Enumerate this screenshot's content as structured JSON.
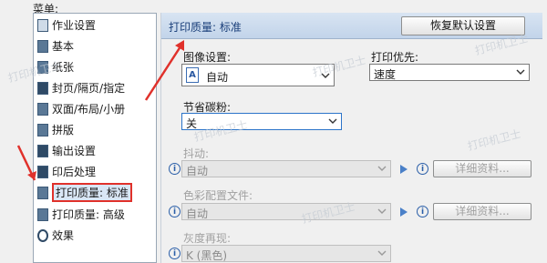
{
  "menu_caption": "菜单:",
  "sidebar": {
    "items": [
      {
        "label": "作业设置"
      },
      {
        "label": "基本"
      },
      {
        "label": "纸张"
      },
      {
        "label": "封页/隔页/指定"
      },
      {
        "label": "双面/布局/小册"
      },
      {
        "label": "拼版"
      },
      {
        "label": "输出设置"
      },
      {
        "label": "印后处理"
      },
      {
        "label": "打印质量: 标准"
      },
      {
        "label": "打印质量: 高级"
      },
      {
        "label": "效果"
      }
    ],
    "selected_index": 8
  },
  "panel": {
    "title": "打印质量: 标准",
    "restore_button": "恢复默认设置",
    "image_settings": {
      "label": "图像设置:",
      "value": "自动"
    },
    "print_priority": {
      "label": "打印优先:",
      "value": "速度"
    },
    "toner_save": {
      "label": "节省碳粉:",
      "value": "关"
    },
    "dither": {
      "label": "抖动:",
      "value": "自动",
      "detail_button": "详细资料..."
    },
    "color_profile": {
      "label": "色彩配置文件:",
      "value": "自动",
      "detail_button": "详细资料..."
    },
    "gray_reproduction": {
      "label": "灰度再现:",
      "value": "K (黑色)"
    }
  },
  "watermark_text": "打印机卫士",
  "colors": {
    "annotation_red": "#e0312b",
    "panel_header": "#c8d8ec",
    "title_blue": "#1a3f7a"
  }
}
